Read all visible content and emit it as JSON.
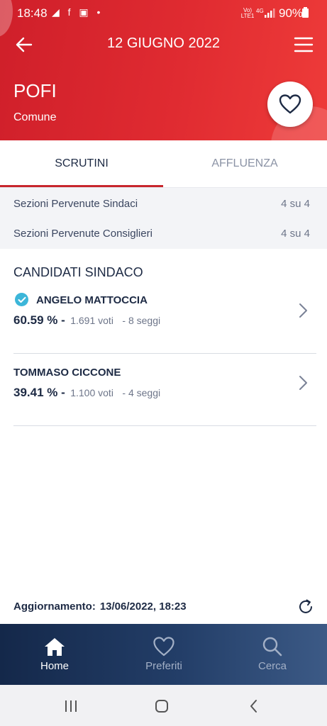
{
  "status_bar": {
    "time": "18:48",
    "left_icons": "◢ f ▣ •",
    "network": "Vo) LTE1",
    "net_gen": "4G",
    "battery": "90%"
  },
  "header": {
    "date": "12 GIUGNO 2022",
    "city": "POFI",
    "city_type": "Comune",
    "accent_color": "#d9262e"
  },
  "tabs": [
    {
      "label": "SCRUTINI",
      "active": true
    },
    {
      "label": "AFFLUENZA",
      "active": false
    }
  ],
  "stats": [
    {
      "label": "Sezioni Pervenute Sindaci",
      "value": "4 su 4"
    },
    {
      "label": "Sezioni Pervenute Consiglieri",
      "value": "4 su 4"
    }
  ],
  "candidates_title": "CANDIDATI SINDACO",
  "candidates": [
    {
      "name": "ANGELO MATTOCCIA",
      "elected": true,
      "percent": "60.59 % -",
      "votes": "1.691 voti",
      "seats": "- 8 seggi"
    },
    {
      "name": "TOMMASO CICCONE",
      "elected": false,
      "percent": "39.41 % -",
      "votes": "1.100 voti",
      "seats": "- 4 seggi"
    }
  ],
  "update": {
    "label": "Aggiornamento:",
    "value": "13/06/2022, 18:23"
  },
  "bottom_nav": [
    {
      "label": "Home",
      "icon": "home-icon",
      "active": true
    },
    {
      "label": "Preferiti",
      "icon": "heart-icon",
      "active": false
    },
    {
      "label": "Cerca",
      "icon": "search-icon",
      "active": false
    }
  ]
}
